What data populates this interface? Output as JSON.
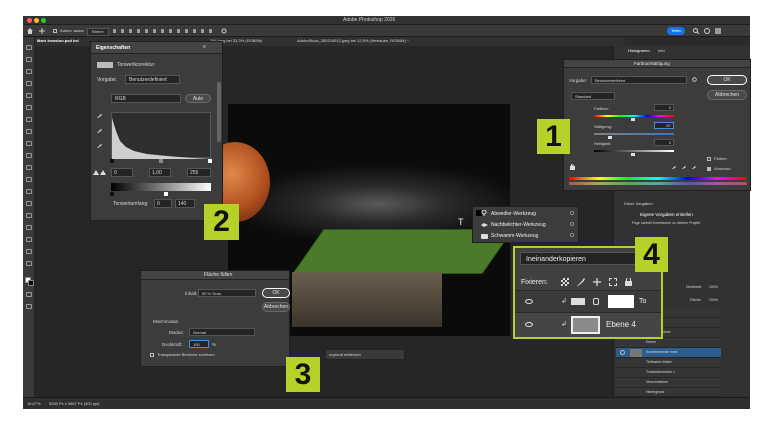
{
  "app": {
    "title": "Adobe Photoshop 2026",
    "share_label": "Teilen",
    "options_label": "Autom. ausw.:",
    "options_select": "Ebene",
    "tab_home": "Mars invasion.psd bei",
    "tab_2": "184.jpeg bei 33,3% (RGB/8#)",
    "tab_3": "AdobeStock_280219012.jpeg bei 12,5% (Vertrauen, RGB/8#) *",
    "status_zoom": "16,67%",
    "status_info": "5000 Px x 3667 Px (300 ppi)"
  },
  "badges": {
    "b1": "1",
    "b2": "2",
    "b3": "3",
    "b4": "4"
  },
  "properties": {
    "title": "Eigenschaften",
    "subtitle": "Tonwertkorrektur",
    "preset_label": "Vorgabe:",
    "preset_value": "Benutzerdefiniert",
    "channel": "RGB",
    "auto_label": "Auto",
    "input_black": "0",
    "input_gamma": "1,00",
    "input_white": "255",
    "output_label": "Tonwertumfang:",
    "output_black": "0",
    "output_white": "140"
  },
  "hue_sat": {
    "title": "Farbton/Sättigung",
    "preset_label": "Vorgabe:",
    "preset_value": "Benutzerdefiniert",
    "ok_label": "OK",
    "cancel_label": "Abbrechen",
    "channel": "Standard",
    "hue_label": "Farbton:",
    "hue_value": "0",
    "sat_label": "Sättigung:",
    "sat_value": "-57",
    "light_label": "Helligkeit:",
    "light_value": "0",
    "colorize_label": "Färben",
    "preview_label": "Vorschau"
  },
  "tools_flyout": {
    "items": [
      {
        "label": "Abwedler-Werkzeug",
        "key": "O"
      },
      {
        "label": "Nachbelichter-Werkzeug",
        "key": "O"
      },
      {
        "label": "Schwamm-Werkzeug",
        "key": "O"
      }
    ]
  },
  "fill": {
    "title": "Fläche füllen",
    "content_label": "Inhalt:",
    "content_value": "50 % Grau",
    "ok_label": "OK",
    "cancel_label": "Abbrechen",
    "blend_heading": "Mischmodus",
    "mode_label": "Modus:",
    "mode_value": "Normal",
    "opacity_label": "Deckkraft:",
    "opacity_value": "100",
    "opacity_unit": "%",
    "preserve_label": "Transparente Bereiche schützen"
  },
  "canvas_bar": {
    "label": "ergrund entfernen"
  },
  "blend_callout": {
    "mode": "Ineinanderkopieren",
    "lock_label": "Fixieren:",
    "layer_name": "Ebene 4",
    "top_letter": "To"
  },
  "right_panel": {
    "tab1": "Histogramm",
    "tab2": "Info",
    "presets_title": "Deine Vorgaben",
    "presets_create": "Eigene Vorgaben erstellen",
    "presets_desc": "Füge schnell Korrekturen zu deinem Projekt",
    "deckkraft_label": "Deckkraft:",
    "deckkraft_value": "100%",
    "flaeche_label": "Fläche:",
    "flaeche_value": "100%",
    "layers": [
      "Ebene 1",
      "Tiefen",
      "Tiefewerk stone",
      "Ebene",
      "Schwimmende Insel",
      "Tiefewerk hinten",
      "Tonwertkorrektur 1",
      "Verschmelzen",
      "Hintergrund"
    ]
  }
}
